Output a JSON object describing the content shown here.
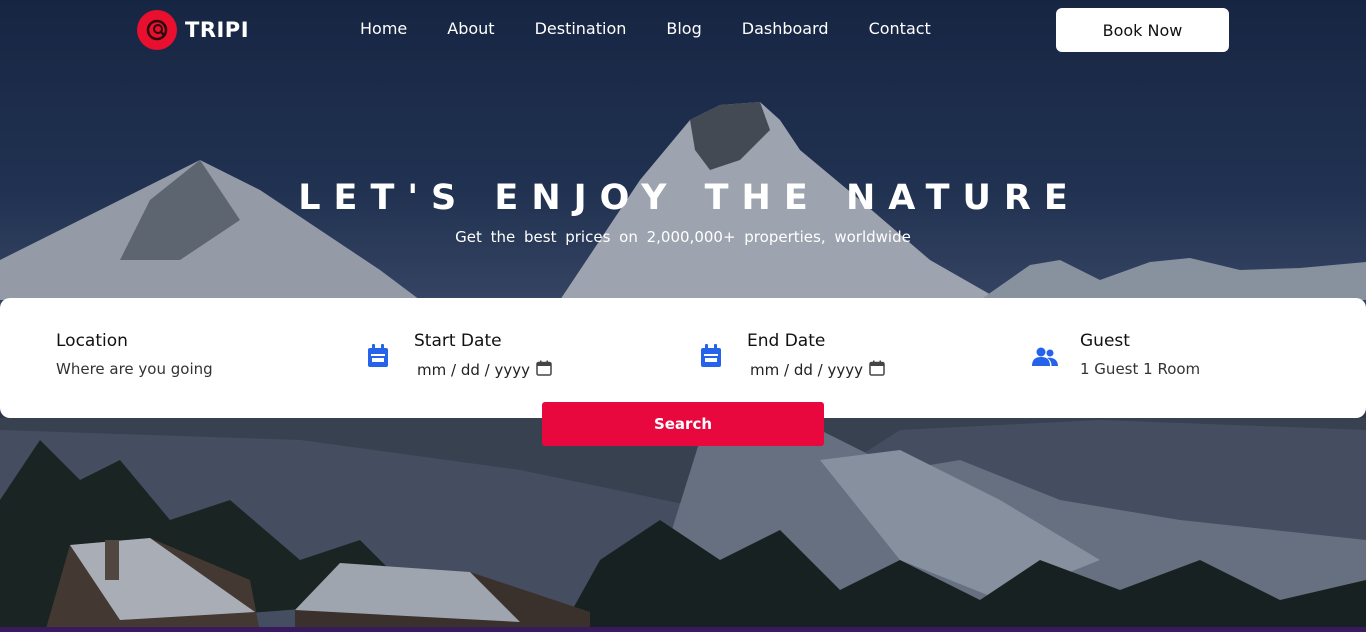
{
  "brand": {
    "name": "TRIPI",
    "accent": "#e8102e"
  },
  "nav": {
    "items": [
      "Home",
      "About",
      "Destination",
      "Blog",
      "Dashboard",
      "Contact"
    ],
    "cta_label": "Book Now"
  },
  "hero": {
    "headline": "LET'S ENJOY THE NATURE",
    "subline": "Get the best prices on 2,000,000+ properties, worldwide"
  },
  "search": {
    "location": {
      "label": "Location",
      "placeholder": "Where are you going"
    },
    "start_date": {
      "label": "Start Date",
      "placeholder": "mm / dd / yyyy",
      "icon": "calendar-icon"
    },
    "end_date": {
      "label": "End Date",
      "placeholder": "mm / dd / yyyy",
      "icon": "calendar-icon"
    },
    "guest": {
      "label": "Guest",
      "value": "1 Guest 1 Room",
      "icon": "users-icon"
    },
    "button_label": "Search",
    "button_color": "#e8083e",
    "icon_color": "#2563eb"
  }
}
